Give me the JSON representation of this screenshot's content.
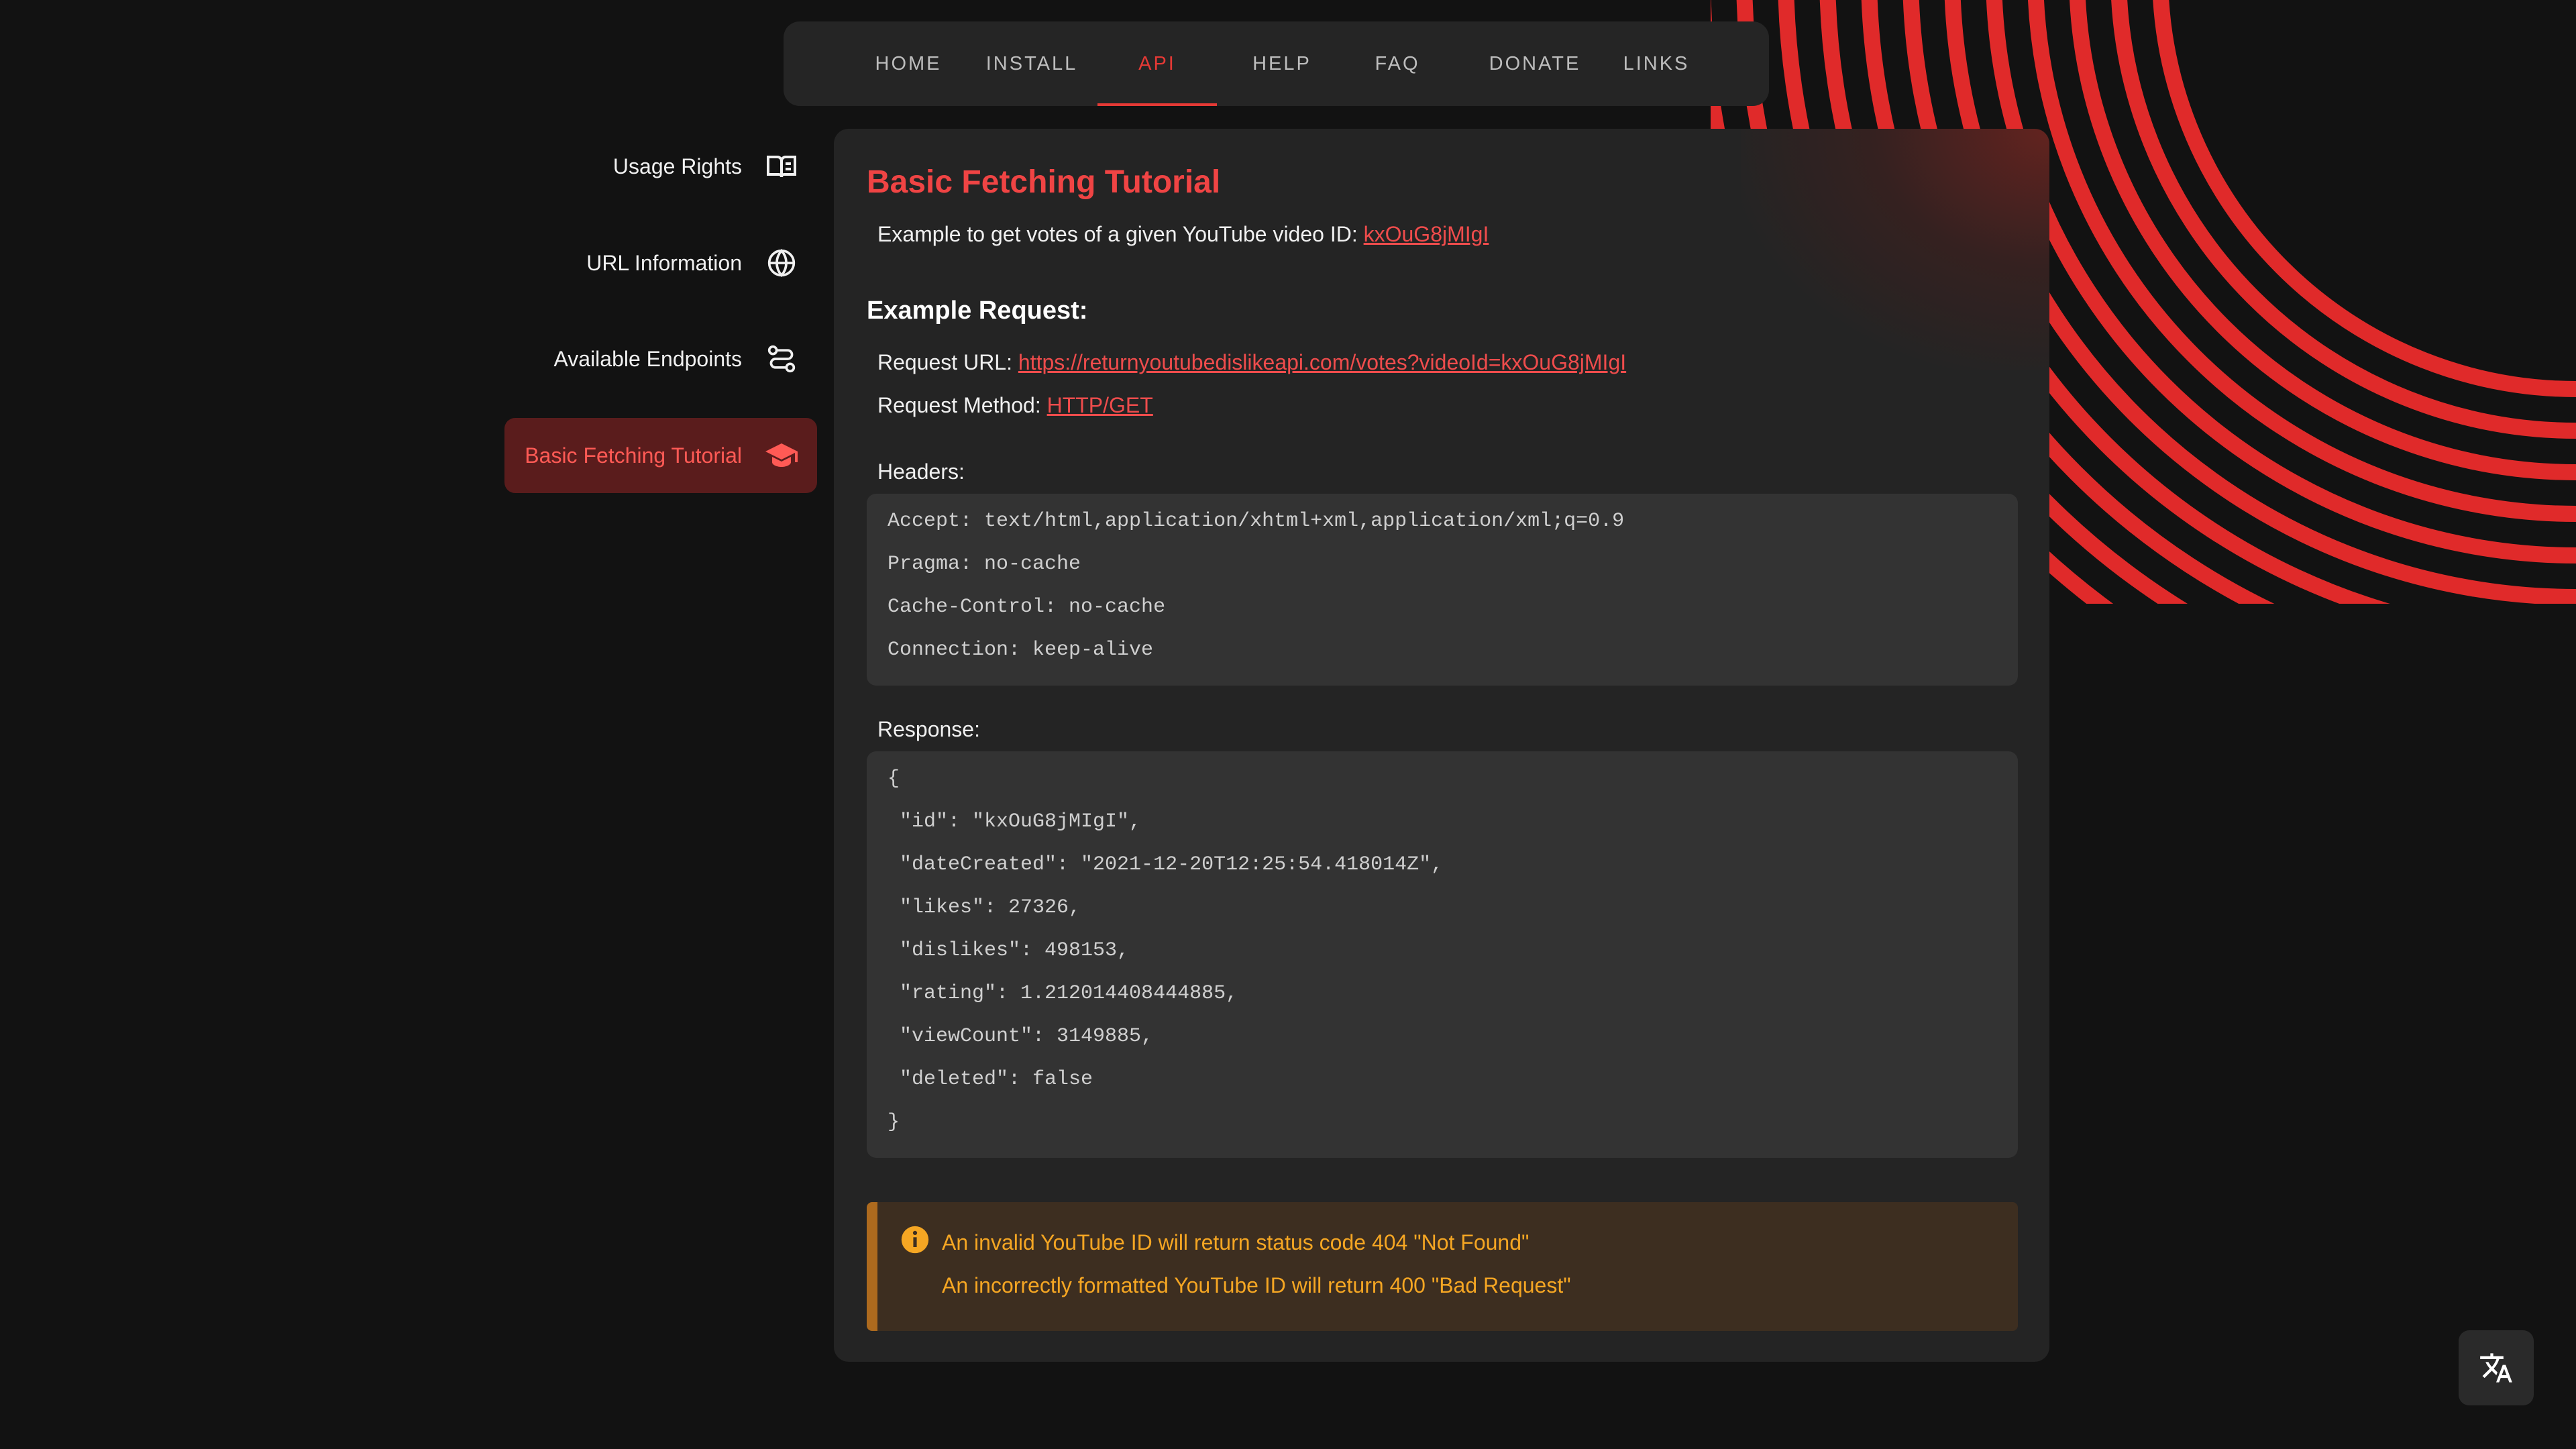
{
  "nav": {
    "items": [
      {
        "label": "HOME"
      },
      {
        "label": "INSTALL"
      },
      {
        "label": "API"
      },
      {
        "label": "HELP"
      },
      {
        "label": "FAQ"
      },
      {
        "label": "DONATE"
      },
      {
        "label": "LINKS"
      }
    ],
    "active": "API"
  },
  "sidebar": {
    "items": [
      {
        "label": "Usage Rights",
        "icon": "book-icon"
      },
      {
        "label": "URL Information",
        "icon": "globe-icon"
      },
      {
        "label": "Available Endpoints",
        "icon": "route-icon"
      },
      {
        "label": "Basic Fetching Tutorial",
        "icon": "graduation-cap-icon"
      }
    ],
    "active": "Basic Fetching Tutorial"
  },
  "content": {
    "title": "Basic Fetching Tutorial",
    "intro_text": "Example to get votes of a given YouTube video ID: ",
    "intro_link": "kxOuG8jMIgI",
    "example_heading": "Example Request:",
    "request_url_label": "Request URL: ",
    "request_url": "https://returnyoutubedislikeapi.com/votes?videoId=kxOuG8jMIgI",
    "request_method_label": "Request Method: ",
    "request_method": "HTTP/GET",
    "headers_label": "Headers:",
    "headers_lines": [
      "Accept: text/html,application/xhtml+xml,application/xml;q=0.9",
      "Pragma: no-cache",
      "Cache-Control: no-cache",
      "Connection: keep-alive"
    ],
    "response_label": "Response:",
    "response_lines": [
      "{",
      " \"id\": \"kxOuG8jMIgI\",",
      " \"dateCreated\": \"2021-12-20T12:25:54.418014Z\",",
      " \"likes\": 27326,",
      " \"dislikes\": 498153,",
      " \"rating\": 1.212014408444885,",
      " \"viewCount\": 3149885,",
      " \"deleted\": false",
      "}"
    ],
    "alert_lines": [
      "An invalid YouTube ID will return status code 404 \"Not Found\"",
      "An incorrectly formatted YouTube ID will return 400 \"Bad Request\""
    ]
  },
  "colors": {
    "accent": "#e53935",
    "background": "#121212",
    "card": "#242424",
    "warning": "#f5a623"
  },
  "icons": {
    "alert": "info-icon",
    "translate": "translate-icon"
  }
}
